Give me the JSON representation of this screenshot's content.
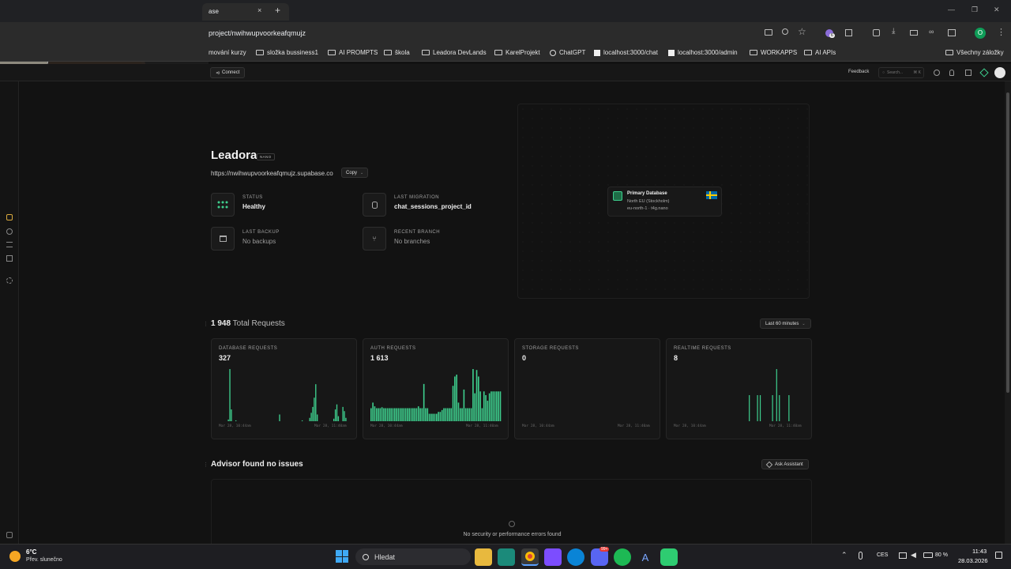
{
  "browser": {
    "tab_title": "ase",
    "tab_close": "×",
    "new_tab": "+",
    "url": "project/nwihwupvoorkeafqmujz",
    "profile_initial": "O",
    "extension_badge": "6",
    "window_minimize": "—",
    "window_maximize": "❐",
    "window_close": "✕"
  },
  "bookmarks": {
    "items": [
      {
        "label": "mování kurzy",
        "icon": "folder-icon"
      },
      {
        "label": "složka bussiness1",
        "icon": "folder-icon"
      },
      {
        "label": "AI PROMPTS",
        "icon": "folder-icon"
      },
      {
        "label": "škola",
        "icon": "folder-icon"
      },
      {
        "label": "Leadora DevLands",
        "icon": "folder-icon"
      },
      {
        "label": "KarelProjekt",
        "icon": "folder-icon"
      },
      {
        "label": "ChatGPT",
        "icon": "chatgpt-icon"
      },
      {
        "label": "localhost:3000/chat",
        "icon": "page-icon"
      },
      {
        "label": "localhost:3000/admin",
        "icon": "page-icon"
      },
      {
        "label": "WORKAPPS",
        "icon": "folder-icon"
      },
      {
        "label": "AI APIs",
        "icon": "folder-icon"
      }
    ],
    "all_bookmarks": "Všechny záložky"
  },
  "appbar": {
    "connect_label": "Connect",
    "feedback_label": "Feedback",
    "search_placeholder": "Search...",
    "search_shortcut": "⌘ K"
  },
  "project": {
    "name": "Leadora",
    "tier_badge": "NANO",
    "url": "https://nwihwupvoorkeafqmujz.supabase.co",
    "copy_label": "Copy",
    "stats": [
      {
        "label": "STATUS",
        "value": "Healthy",
        "icon": "status-dots-icon"
      },
      {
        "label": "LAST MIGRATION",
        "value": "chat_sessions_project_id",
        "icon": "database-icon"
      },
      {
        "label": "LAST BACKUP",
        "value": "No backups",
        "icon": "archive-icon"
      },
      {
        "label": "RECENT BRANCH",
        "value": "No branches",
        "icon": "branch-icon"
      }
    ]
  },
  "database_node": {
    "title": "Primary Database",
    "region": "North EU (Stockholm)",
    "instance": "eu-north-1 · t4g.nano",
    "flag": "sweden-flag"
  },
  "requests": {
    "total": "1 948",
    "total_label": "Total Requests",
    "range_label": "Last 60 minutes",
    "time_start": "Mar 28, 10:44am",
    "time_end": "Mar 28, 11:40am"
  },
  "chart_data": [
    {
      "type": "bar",
      "title": "DATABASE REQUESTS",
      "total": "327",
      "color": "#3ecf8e",
      "values": [
        0,
        0,
        0,
        0,
        0,
        0,
        2,
        62,
        14,
        0,
        0,
        1,
        0,
        0,
        0,
        0,
        0,
        0,
        0,
        0,
        0,
        0,
        0,
        0,
        0,
        0,
        0,
        0,
        0,
        0,
        0,
        0,
        0,
        0,
        0,
        0,
        0,
        0,
        0,
        0,
        8,
        0,
        0,
        0,
        0,
        0,
        0,
        0,
        0,
        0,
        0,
        0,
        0,
        0,
        0,
        1,
        0,
        0,
        0,
        0,
        4,
        10,
        17,
        28,
        44,
        8,
        0,
        0,
        0,
        0,
        0,
        0,
        0,
        0,
        0,
        0,
        3,
        14,
        20,
        6,
        0,
        0,
        17,
        12,
        4,
        0,
        0
      ]
    },
    {
      "type": "bar",
      "title": "AUTH REQUESTS",
      "total": "1 613",
      "color": "#3ecf8e",
      "values": [
        14,
        20,
        16,
        14,
        14,
        14,
        15,
        14,
        14,
        14,
        14,
        14,
        14,
        14,
        14,
        14,
        14,
        14,
        14,
        14,
        14,
        14,
        14,
        14,
        14,
        14,
        16,
        14,
        14,
        40,
        14,
        14,
        8,
        8,
        8,
        8,
        8,
        10,
        10,
        12,
        14,
        14,
        14,
        14,
        14,
        38,
        48,
        50,
        20,
        14,
        14,
        34,
        14,
        14,
        14,
        14,
        56,
        30,
        55,
        48,
        32,
        14,
        32,
        28,
        22,
        30,
        32,
        32,
        32,
        32,
        32,
        32
      ]
    },
    {
      "type": "bar",
      "title": "STORAGE REQUESTS",
      "total": "0",
      "color": "#3ecf8e",
      "values": [
        0,
        0,
        0,
        0,
        0,
        0,
        0,
        0,
        0,
        0,
        0,
        0,
        0,
        0,
        0,
        0,
        0,
        0,
        0,
        0
      ]
    },
    {
      "type": "bar",
      "title": "REALTIME REQUESTS",
      "total": "8",
      "color": "#3ecf8e",
      "values": [
        0,
        0,
        0,
        0,
        0,
        0,
        0,
        0,
        0,
        0,
        0,
        0,
        0,
        0,
        0,
        0,
        0,
        0,
        0,
        0,
        0,
        0,
        0,
        0,
        0,
        0,
        0,
        0,
        0,
        0,
        0,
        0,
        0,
        0,
        0,
        0,
        0,
        0,
        0,
        0,
        0,
        0,
        0,
        0,
        0,
        0,
        0,
        0,
        0,
        0,
        0,
        0,
        0,
        0,
        0,
        1,
        0,
        0,
        0,
        0,
        0,
        1,
        0,
        1,
        0,
        0,
        0,
        0,
        0,
        0,
        0,
        0,
        1,
        0,
        0,
        2,
        0,
        1,
        0,
        0,
        0,
        0,
        0,
        0,
        1,
        0,
        0,
        0,
        0,
        0,
        0,
        0,
        0,
        0,
        0,
        0
      ]
    }
  ],
  "advisor": {
    "title": "Advisor found no issues",
    "ask_label": "Ask Assistant",
    "empty_text": "No security or performance errors found"
  },
  "taskbar": {
    "weather_temp": "6°C",
    "weather_desc": "Přev. slunečno",
    "search_label": "Hledat",
    "language": "CES",
    "battery": "80 %",
    "time": "11:43",
    "date": "28.03.2026",
    "discord_badge": "99+"
  }
}
